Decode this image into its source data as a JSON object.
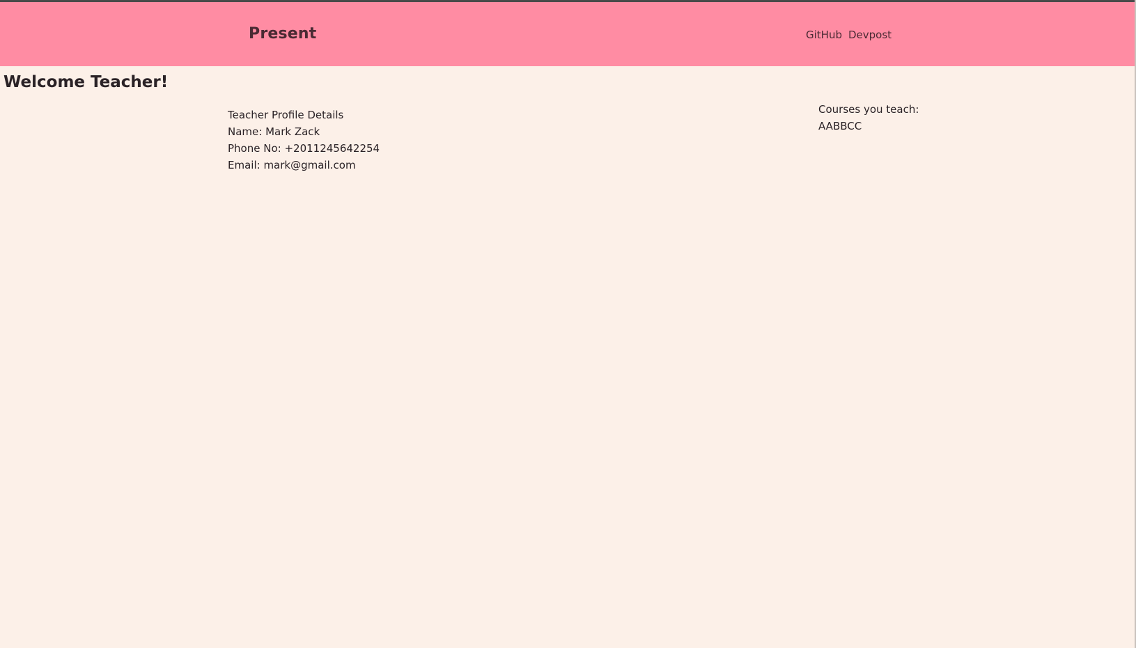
{
  "navbar": {
    "brand": "Present",
    "links": [
      {
        "label": "GitHub"
      },
      {
        "label": "Devpost"
      }
    ],
    "background": "#ff8ca3"
  },
  "page": {
    "background": "#fcf0e8",
    "welcome": "Welcome Teacher!"
  },
  "profile": {
    "heading": "Teacher Profile Details",
    "name_line": "Name: Mark Zack",
    "phone_line": "Phone No: +2011245642254",
    "email_line": "Email: mark@gmail.com"
  },
  "courses": {
    "heading": "Courses you teach:",
    "items": [
      "AABBCC"
    ]
  }
}
